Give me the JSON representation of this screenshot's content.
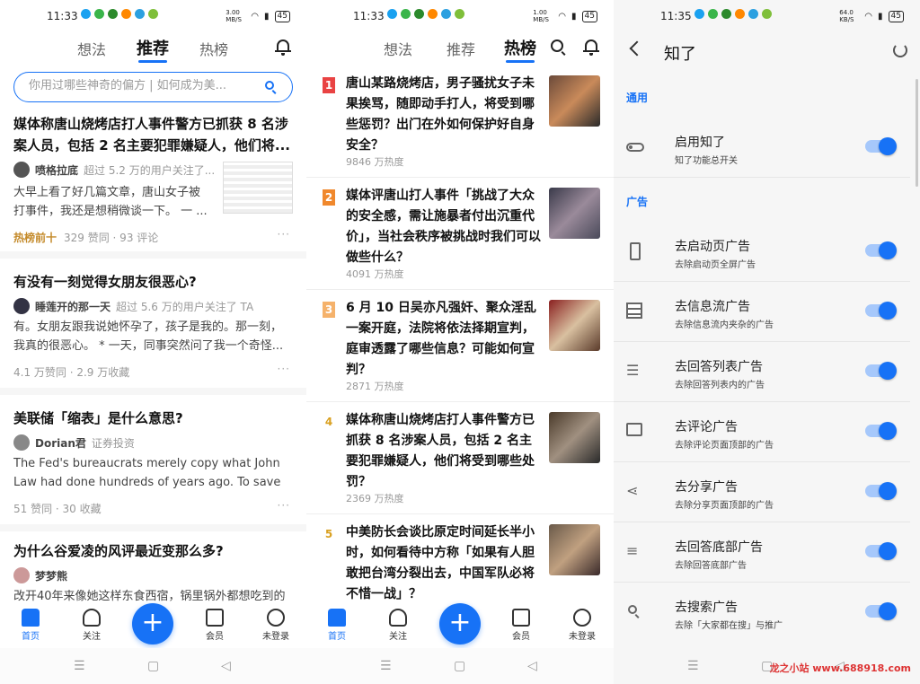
{
  "panel1": {
    "status": {
      "time": "11:33",
      "speed": "3.00 MB/S",
      "battery": "45"
    },
    "tabs": [
      "想法",
      "推荐",
      "热榜"
    ],
    "search_placeholder": "你用过哪些神奇的偏方 | 如何成为美...",
    "feed": [
      {
        "title": "媒体称唐山烧烤店打人事件警方已抓获 8 名涉案人员，包括 2 名主要犯罪嫌疑人，他们将...",
        "author": "喷格拉底",
        "meta": "超过 5.2 万的用户关注了...",
        "excerpt": "大早上看了好几篇文章，唐山女子被打事件，我还是想稍微谈一下。 一 ...",
        "badge": "热榜前十",
        "stats": "329 赞同 · 93 评论"
      },
      {
        "title": "有没有一刻觉得女朋友很恶心?",
        "author": "睡莲开的那一天",
        "meta": "超过 5.6 万的用户关注了 TA",
        "excerpt": "有。女朋友跟我说她怀孕了，孩子是我的。那一刻，我真的很恶心。 * 一天，同事突然问了我一个奇怪...",
        "stats": "4.1 万赞同 · 2.9 万收藏"
      },
      {
        "title": "美联储「缩表」是什么意思?",
        "author": "Dorian君",
        "meta": "证券投资",
        "excerpt": "The Fed's bureaucrats merely copy what John Law had done hundreds of years ago. To save France fr...",
        "stats": "51 赞同 · 30 收藏"
      },
      {
        "title": "为什么谷爱凌的风评最近变那么多?",
        "author": "梦梦熊",
        "meta": "",
        "excerpt": "改开40年来像她这样东食西宿，锅里锅外都想吃到的",
        "stats": ""
      }
    ],
    "bottom": [
      "首页",
      "关注",
      "会员",
      "未登录"
    ]
  },
  "panel2": {
    "status": {
      "time": "11:33",
      "speed": "1.00 MB/S",
      "battery": "45"
    },
    "tabs": [
      "想法",
      "推荐",
      "热榜"
    ],
    "hot": [
      {
        "rank": "1",
        "title": "唐山某路烧烤店，男子骚扰女子未果挨骂，随即动手打人，将受到哪些惩罚？出门在外如何保护好自身安全？",
        "heat": "9846 万热度",
        "color": "#e94343"
      },
      {
        "rank": "2",
        "title": "媒体评唐山打人事件「挑战了大众的安全感，需让施暴者付出沉重代价」，当社会秩序被挑战时我们可以做些什么？",
        "heat": "4091 万热度",
        "color": "#f0882c"
      },
      {
        "rank": "3",
        "title": "6 月 10 日吴亦凡强奸、聚众淫乱一案开庭，法院将依法择期宣判，庭审透露了哪些信息？可能如何宣判？",
        "heat": "2871 万热度",
        "color": "#f5b26b"
      },
      {
        "rank": "4",
        "title": "媒体称唐山烧烤店打人事件警方已抓获 8 名涉案人员，包括 2 名主要犯罪嫌疑人，他们将受到哪些处罚？",
        "heat": "2369 万热度",
        "color": "#d9a020"
      },
      {
        "rank": "5",
        "title": "中美防长会谈比原定时间延长半小时，如何看待中方称「如果有人胆敢把台湾分裂出去，中国军队必将不惜一战」？",
        "heat": "",
        "color": "#d9a020"
      }
    ],
    "bottom": [
      "首页",
      "关注",
      "会员",
      "未登录"
    ]
  },
  "panel3": {
    "status": {
      "time": "11:35",
      "speed": "64.0 KB/S",
      "battery": "45"
    },
    "title": "知了",
    "section_general": "通用",
    "section_ads": "广告",
    "rows": [
      {
        "title": "启用知了",
        "sub": "知了功能总开关",
        "icon": "toggle-icon"
      },
      {
        "title": "去启动页广告",
        "sub": "去除启动页全屏广告",
        "icon": "phone-icon"
      },
      {
        "title": "去信息流广告",
        "sub": "去除信息流内夹杂的广告",
        "icon": "feed-icon"
      },
      {
        "title": "去回答列表广告",
        "sub": "去除回答列表内的广告",
        "icon": "list-icon"
      },
      {
        "title": "去评论广告",
        "sub": "去除评论页面顶部的广告",
        "icon": "comment-icon"
      },
      {
        "title": "去分享广告",
        "sub": "去除分享页面顶部的广告",
        "icon": "share-icon"
      },
      {
        "title": "去回答底部广告",
        "sub": "去除回答底部广告",
        "icon": "lines-icon"
      },
      {
        "title": "去搜索广告",
        "sub": "去除「大家都在搜」与推广",
        "icon": "search-icon"
      }
    ]
  },
  "watermark": "龙之小站 www.688918.com",
  "colors": {
    "accent": "#1772f6"
  }
}
